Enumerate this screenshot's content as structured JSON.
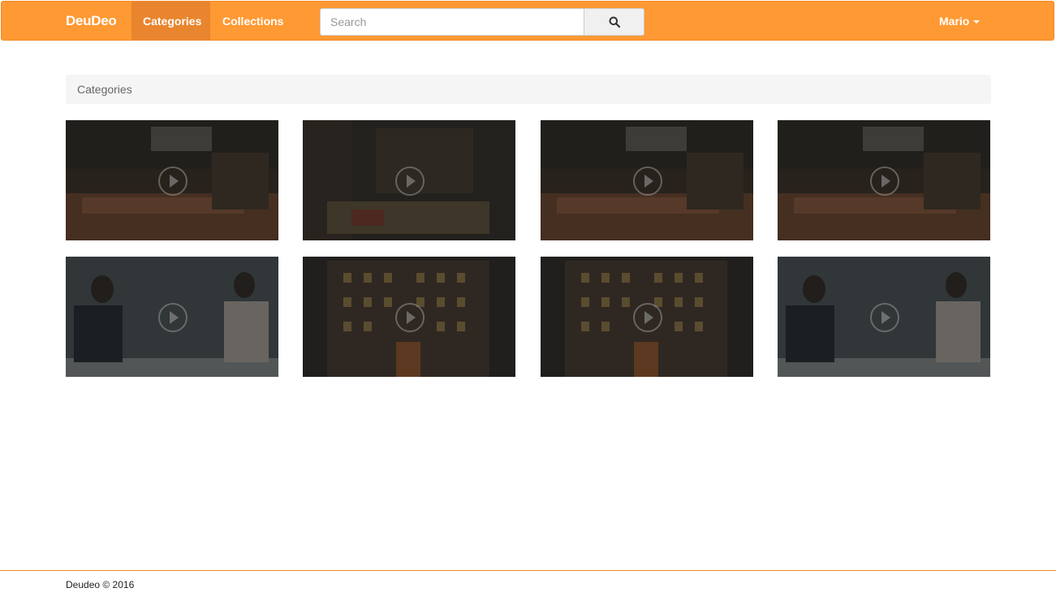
{
  "colors": {
    "brand": "#ff9933",
    "active_nav": "#e9852e",
    "footer_border": "#f08a24"
  },
  "navbar": {
    "brand": "DeuDeo",
    "links": [
      {
        "label": "Categories",
        "active": true
      },
      {
        "label": "Collections",
        "active": false
      }
    ],
    "search": {
      "placeholder": "Search",
      "value": "",
      "button_icon": "search-icon"
    },
    "user": {
      "name": "Mario",
      "icon": "caret-down-icon"
    }
  },
  "breadcrumb": {
    "label": "Categories"
  },
  "videos": [
    {
      "scene": "market-stall",
      "icon": "play-icon"
    },
    {
      "scene": "market-street",
      "icon": "play-icon"
    },
    {
      "scene": "market-stall",
      "icon": "play-icon"
    },
    {
      "scene": "market-stall",
      "icon": "play-icon"
    },
    {
      "scene": "two-women-talking",
      "icon": "play-icon"
    },
    {
      "scene": "building-at-night",
      "icon": "play-icon"
    },
    {
      "scene": "building-at-night",
      "icon": "play-icon"
    },
    {
      "scene": "two-women-talking",
      "icon": "play-icon"
    }
  ],
  "footer": {
    "text": "Deudeo © 2016"
  }
}
